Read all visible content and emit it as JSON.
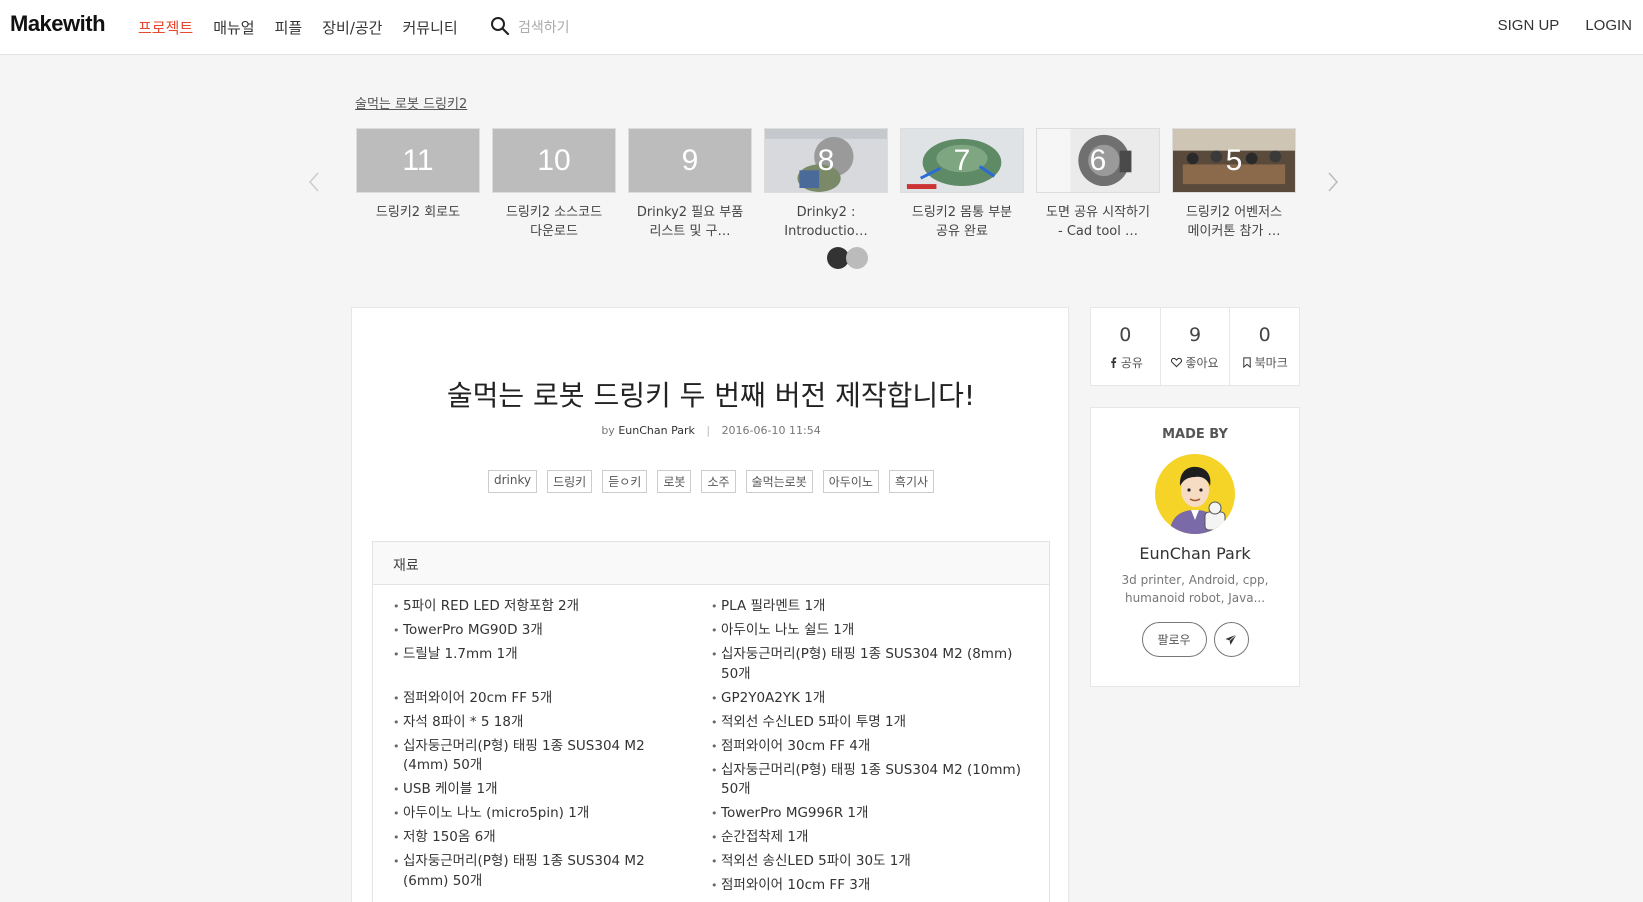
{
  "header": {
    "logo": "Makewith",
    "nav": [
      {
        "label": "프로젝트",
        "active": true
      },
      {
        "label": "매뉴얼"
      },
      {
        "label": "피플"
      },
      {
        "label": "장비/공간"
      },
      {
        "label": "커뮤니티"
      }
    ],
    "search_placeholder": "검색하기",
    "signup": "SIGN UP",
    "login": "LOGIN"
  },
  "series": {
    "title": "술먹는 로봇 드링키2",
    "items": [
      {
        "num": "11",
        "caption": "드링키2 회로도",
        "has_image": false
      },
      {
        "num": "10",
        "caption": "드링키2 소스코드 다운로드",
        "has_image": false
      },
      {
        "num": "9",
        "caption": "Drinky2 필요 부품 리스트 및 구…",
        "has_image": false
      },
      {
        "num": "8",
        "caption": "Drinky2 : Introductio…",
        "has_image": true
      },
      {
        "num": "7",
        "caption": "드링키2 몸통 부분 공유 완료",
        "has_image": true
      },
      {
        "num": "6",
        "caption": "도면 공유 시작하기 - Cad tool …",
        "has_image": true
      },
      {
        "num": "5",
        "caption": "드링키2 어벤저스 메이커톤 참가 …",
        "has_image": true
      }
    ],
    "dots": 2,
    "active_dot": 0
  },
  "article": {
    "title": "술먹는 로봇 드링키 두 번째 버전 제작합니다!",
    "by": "by",
    "author": "EunChan Park",
    "date": "2016-06-10 11:54",
    "tags": [
      "drinky",
      "드링키",
      "듣ㅇ키",
      "로봇",
      "소주",
      "술먹는로봇",
      "아두이노",
      "흑기사"
    ],
    "materials_title": "재료",
    "materials_left": [
      "5파이 RED LED 저항포함 2개",
      "TowerPro MG90D 3개",
      "드릴날 1.7mm 1개",
      "점퍼와이어 20cm FF 5개",
      "자석 8파이 * 5 18개",
      "십자둥근머리(P형) 태핑 1종 SUS304 M2 (4mm) 50개",
      "USB 케이블 1개",
      "아두이노 나노 (micro5pin) 1개",
      "저항 150옴 6개",
      "십자둥근머리(P형) 태핑 1종 SUS304 M2 (6mm) 50개"
    ],
    "materials_right": [
      "PLA 필라멘트 1개",
      "아두이노 나노 쉴드 1개",
      "십자둥근머리(P형) 태핑 1종 SUS304 M2 (8mm) 50개",
      "GP2Y0A2YK 1개",
      "적외선 수신LED 5파이 투명 1개",
      "점퍼와이어 30cm FF 4개",
      "십자둥근머리(P형) 태핑 1종 SUS304 M2 (10mm) 50개",
      "TowerPro MG996R 1개",
      "순간접착제 1개",
      "적외선 송신LED 5파이 30도 1개",
      "점퍼와이어 10cm FF 3개"
    ]
  },
  "stats": {
    "share_count": "0",
    "share_label": "공유",
    "like_count": "9",
    "like_label": "좋아요",
    "bookmark_count": "0",
    "bookmark_label": "북마크"
  },
  "maker": {
    "heading": "MADE BY",
    "name": "EunChan Park",
    "bio": "3d printer, Android, cpp, humanoid robot, Java...",
    "follow": "팔로우"
  },
  "colors": {
    "accent": "#e8492f",
    "avatar_bg": "#f5d327"
  }
}
